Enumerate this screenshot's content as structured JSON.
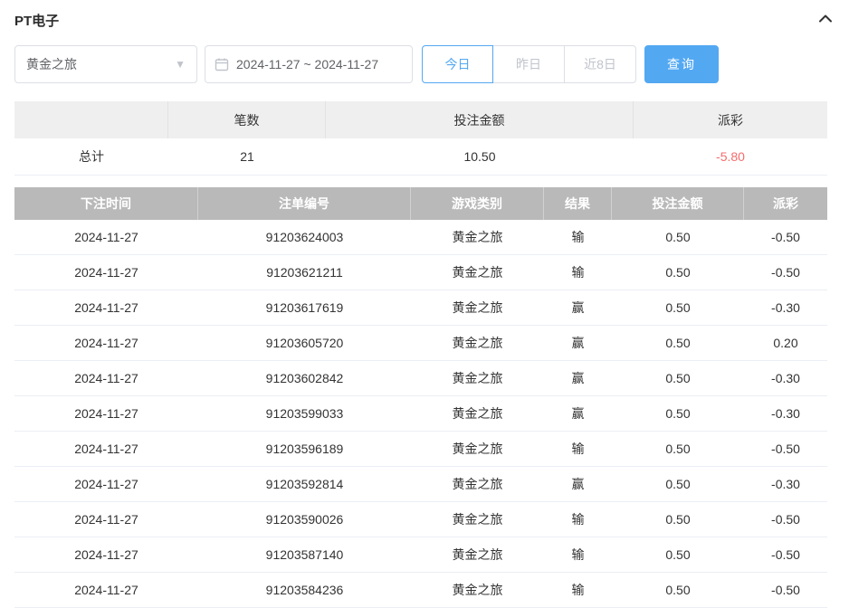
{
  "header": {
    "title": "PT电子",
    "collapse_icon": "chevron-up-icon"
  },
  "filters": {
    "game_select": {
      "value": "黄金之旅",
      "caret_icon": "chevron-down-icon"
    },
    "date_range": {
      "value": "2024-11-27 ~ 2024-11-27",
      "icon": "calendar-icon"
    },
    "quick_buttons": [
      {
        "label": "今日",
        "active": true
      },
      {
        "label": "昨日",
        "active": false
      },
      {
        "label": "近8日",
        "active": false
      }
    ],
    "search_label": "查询"
  },
  "summary": {
    "headers": [
      "",
      "笔数",
      "投注金额",
      "派彩"
    ],
    "row_label": "总计",
    "count": "21",
    "bet_amount": "10.50",
    "payout": "-5.80"
  },
  "table": {
    "headers": [
      "下注时间",
      "注单编号",
      "游戏类别",
      "结果",
      "投注金额",
      "派彩"
    ],
    "rows": [
      {
        "time": "2024-11-27",
        "order_id": "91203624003",
        "game": "黄金之旅",
        "result": "输",
        "bet": "0.50",
        "payout": "-0.50"
      },
      {
        "time": "2024-11-27",
        "order_id": "91203621211",
        "game": "黄金之旅",
        "result": "输",
        "bet": "0.50",
        "payout": "-0.50"
      },
      {
        "time": "2024-11-27",
        "order_id": "91203617619",
        "game": "黄金之旅",
        "result": "赢",
        "bet": "0.50",
        "payout": "-0.30"
      },
      {
        "time": "2024-11-27",
        "order_id": "91203605720",
        "game": "黄金之旅",
        "result": "赢",
        "bet": "0.50",
        "payout": "0.20"
      },
      {
        "time": "2024-11-27",
        "order_id": "91203602842",
        "game": "黄金之旅",
        "result": "赢",
        "bet": "0.50",
        "payout": "-0.30"
      },
      {
        "time": "2024-11-27",
        "order_id": "91203599033",
        "game": "黄金之旅",
        "result": "赢",
        "bet": "0.50",
        "payout": "-0.30"
      },
      {
        "time": "2024-11-27",
        "order_id": "91203596189",
        "game": "黄金之旅",
        "result": "输",
        "bet": "0.50",
        "payout": "-0.50"
      },
      {
        "time": "2024-11-27",
        "order_id": "91203592814",
        "game": "黄金之旅",
        "result": "赢",
        "bet": "0.50",
        "payout": "-0.30"
      },
      {
        "time": "2024-11-27",
        "order_id": "91203590026",
        "game": "黄金之旅",
        "result": "输",
        "bet": "0.50",
        "payout": "-0.50"
      },
      {
        "time": "2024-11-27",
        "order_id": "91203587140",
        "game": "黄金之旅",
        "result": "输",
        "bet": "0.50",
        "payout": "-0.50"
      },
      {
        "time": "2024-11-27",
        "order_id": "91203584236",
        "game": "黄金之旅",
        "result": "输",
        "bet": "0.50",
        "payout": "-0.50"
      }
    ]
  },
  "colors": {
    "accent": "#53a8f2",
    "negative": "#f56c6c",
    "table_header_bg": "#b9b9b9",
    "summary_header_bg": "#efefef"
  }
}
